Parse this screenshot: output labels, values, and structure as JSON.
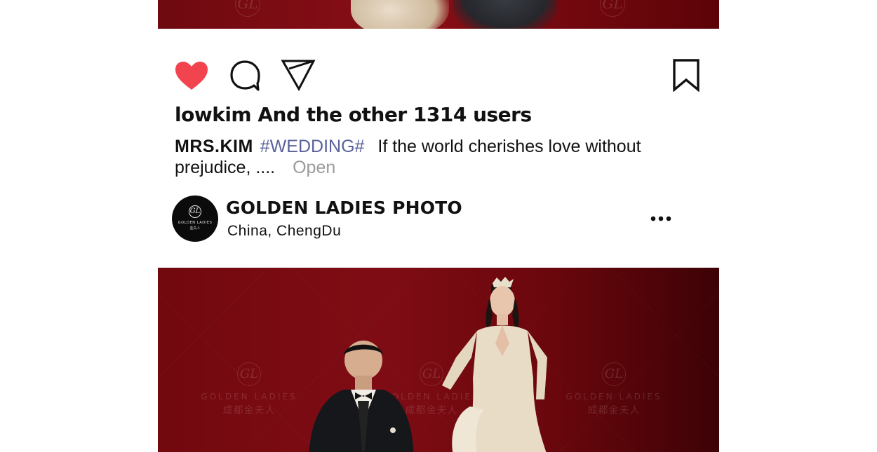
{
  "post": {
    "likes_text": "lowkim And the other 1314 users",
    "caption": {
      "author": "MRS.KIM",
      "hashtag": "#WEDDING#",
      "text": "If the world cherishes love without prejudice, ....",
      "open_label": "Open"
    }
  },
  "account": {
    "name": "GOLDEN LADIES PHOTO",
    "location": "China, ChengDu",
    "avatar_brand": "GOLDEN LADIES",
    "avatar_brand_sub": "金夫人"
  },
  "watermark": {
    "brand_en": "GOLDEN LADIES",
    "brand_cn": "成都金夫人",
    "monogram": "GL"
  },
  "icons": {
    "like": "heart-icon",
    "comment": "comment-bubble-icon",
    "share": "paper-plane-icon",
    "save": "bookmark-icon",
    "more": "more-dots-icon"
  },
  "colors": {
    "like_red": "#f2444f",
    "hashtag": "#5b629b",
    "open_gray": "#9a9a9a",
    "photo_red": "#7f0c14"
  }
}
